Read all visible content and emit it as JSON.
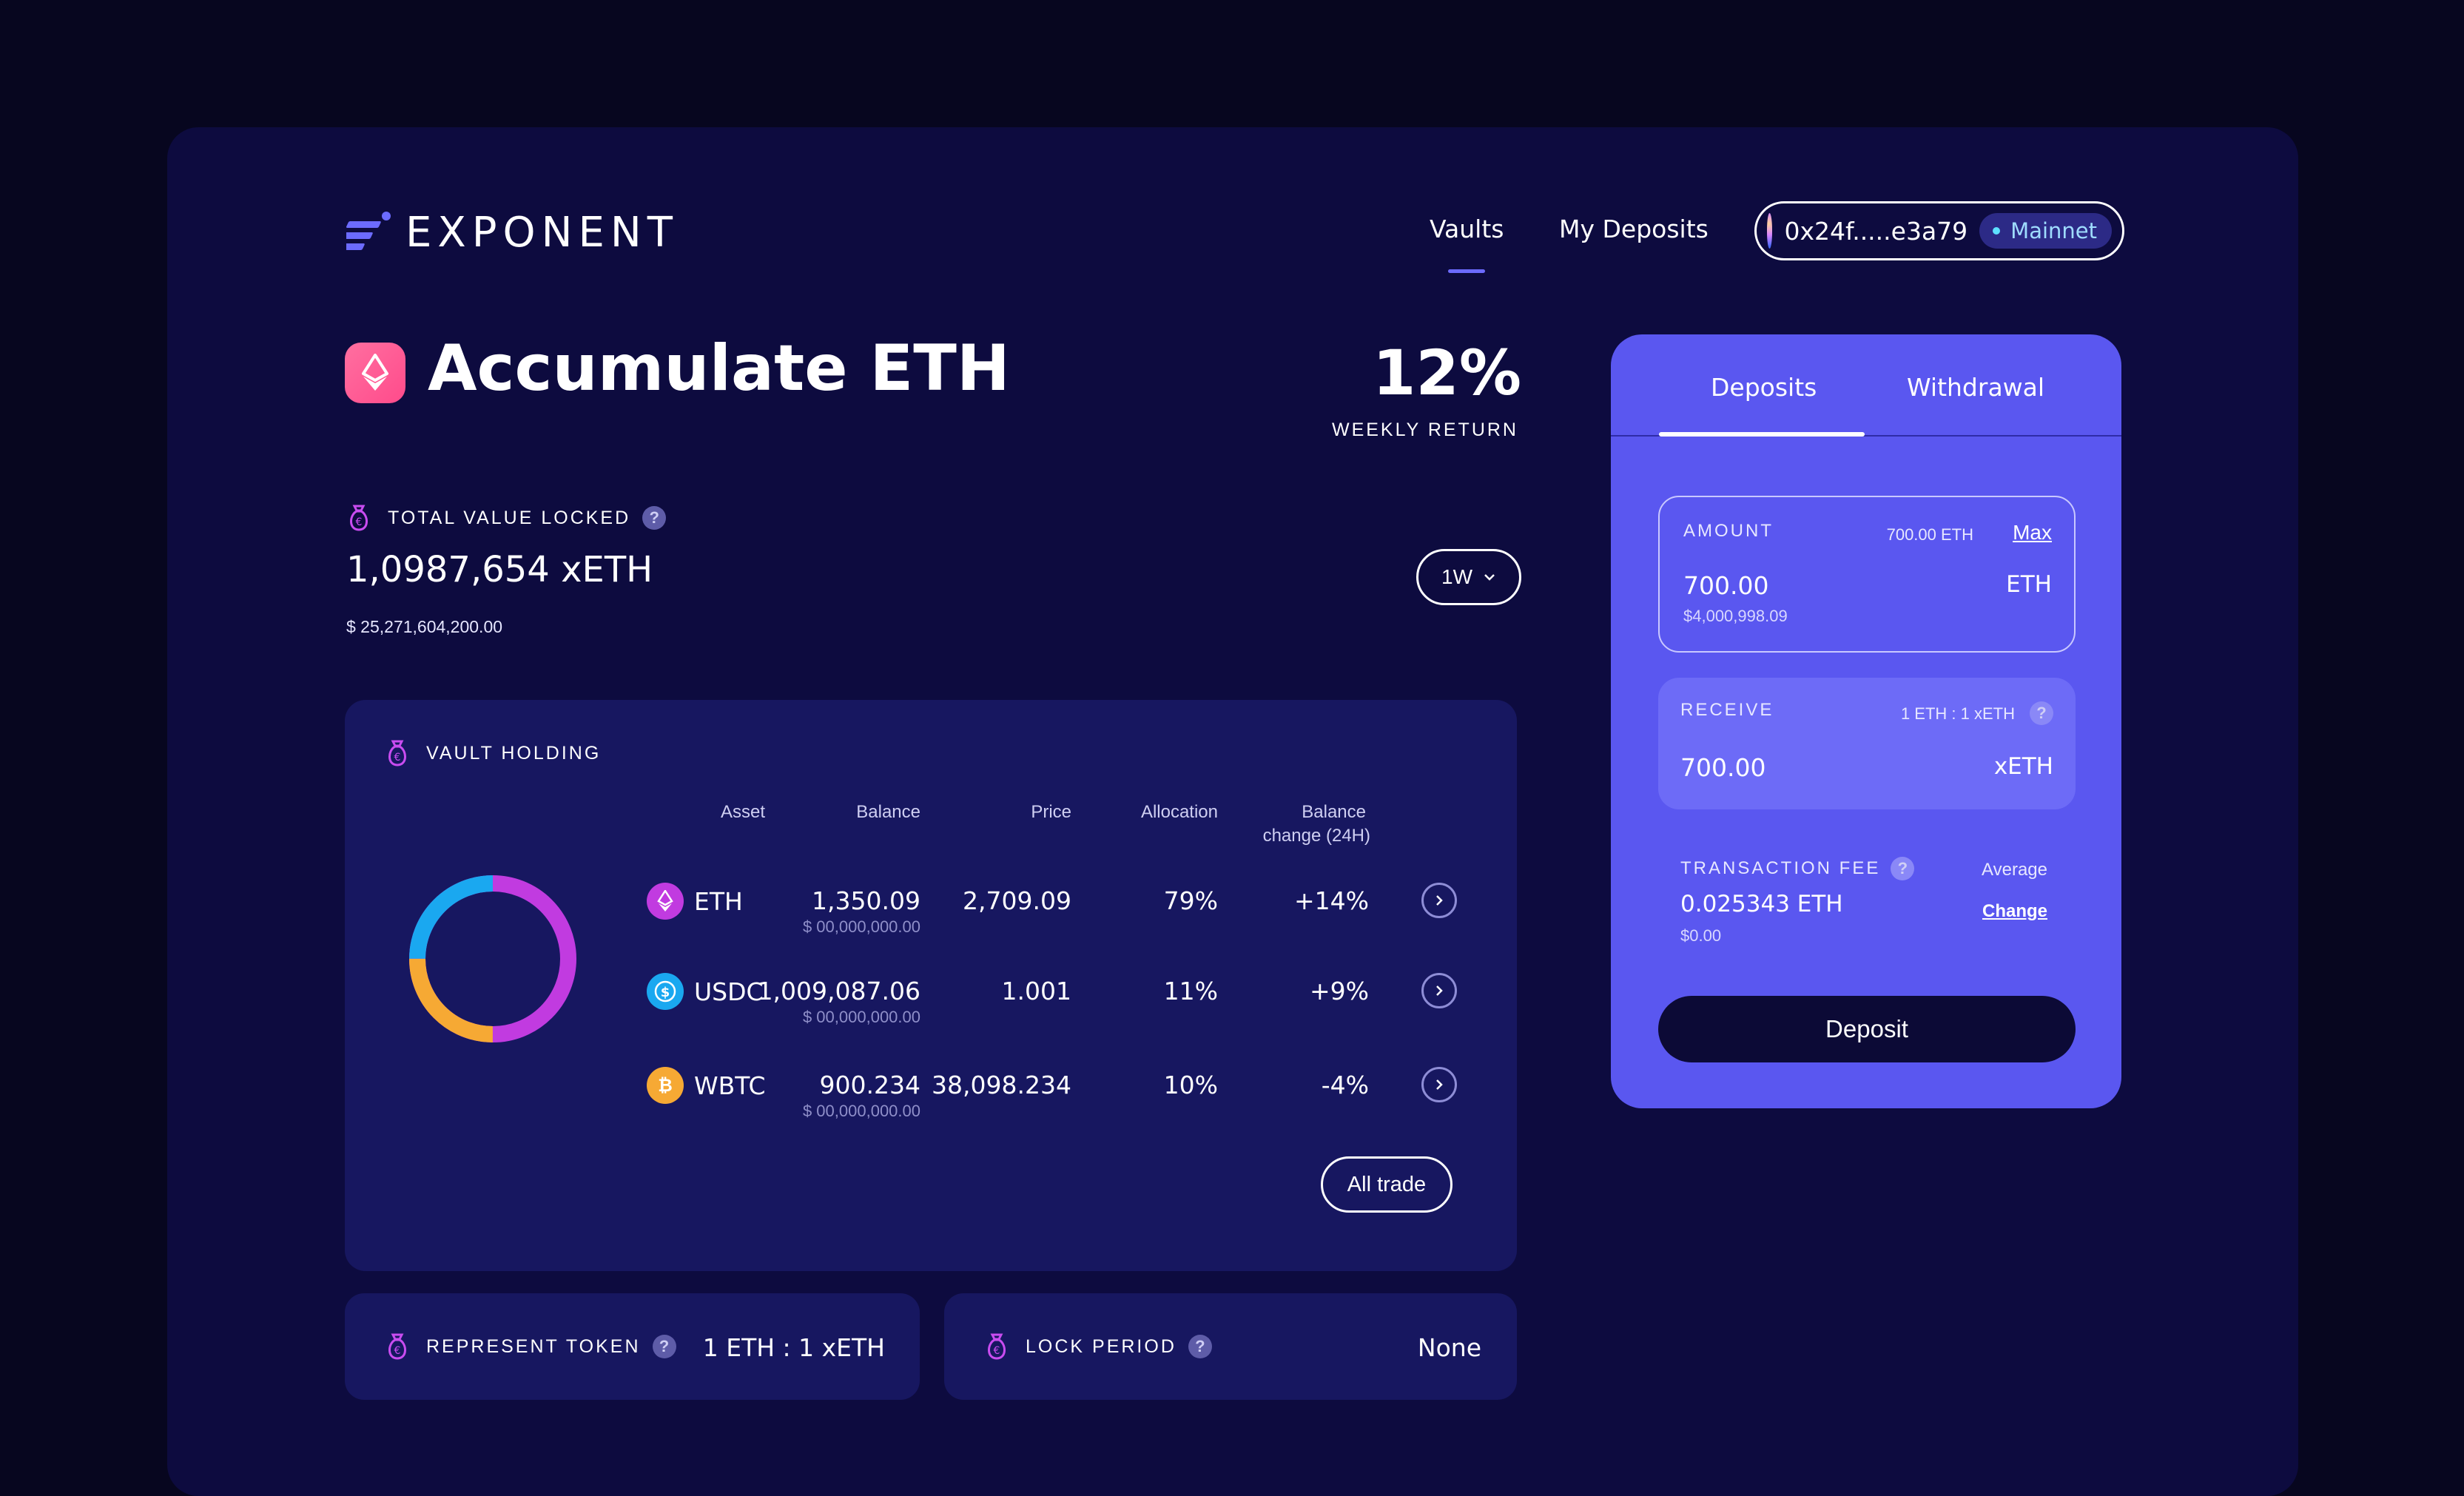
{
  "brand": {
    "name": "EXPONENT"
  },
  "nav": {
    "items": [
      {
        "label": "Vaults",
        "active": true
      },
      {
        "label": "My Deposits",
        "active": false
      }
    ]
  },
  "wallet": {
    "address": "0x24f.....e3a79",
    "network": "Mainnet"
  },
  "vault": {
    "title": "Accumulate ETH",
    "weekly_return": "12%",
    "weekly_return_label": "WEEKLY RETURN"
  },
  "tvl": {
    "label": "TOTAL VALUE LOCKED",
    "value": "1,0987,654 xETH",
    "usd": "$ 25,271,604,200.00",
    "period": "1W"
  },
  "holding": {
    "label": "VAULT HOLDING",
    "headers": {
      "asset": "Asset",
      "balance": "Balance",
      "price": "Price",
      "allocation": "Allocation",
      "change_line1": "Balance",
      "change_line2": "change (24H)"
    },
    "rows": [
      {
        "asset": "ETH",
        "balance": "1,350.09",
        "balance_usd": "$ 00,000,000.00",
        "price": "2,709.09",
        "allocation": "79%",
        "change": "+14%",
        "color": "#c13be0"
      },
      {
        "asset": "USDC",
        "balance": "1,009,087.06",
        "balance_usd": "$ 00,000,000.00",
        "price": "1.001",
        "allocation": "11%",
        "change": "+9%",
        "color": "#1aa8f0"
      },
      {
        "asset": "WBTC",
        "balance": "900.234",
        "balance_usd": "$ 00,000,000.00",
        "price": "38,098.234",
        "allocation": "10%",
        "change": "-4%",
        "color": "#f6a934"
      }
    ],
    "all_trade": "All trade",
    "donut": [
      {
        "name": "ETH",
        "color": "#c13be0",
        "value": 50
      },
      {
        "name": "USDC",
        "color": "#1aa8f0",
        "value": 25
      },
      {
        "name": "WBTC",
        "color": "#f6a934",
        "value": 25
      }
    ]
  },
  "represent_token": {
    "label": "REPRESENT TOKEN",
    "value": "1 ETH : 1 xETH"
  },
  "lock_period": {
    "label": "LOCK PERIOD",
    "value": "None"
  },
  "panel": {
    "tabs": [
      "Deposits",
      "Withdrawal"
    ],
    "amount": {
      "label": "AMOUNT",
      "balance": "700.00 ETH",
      "max": "Max",
      "value": "700.00",
      "usd": "$4,000,998.09",
      "unit": "ETH"
    },
    "receive": {
      "label": "RECEIVE",
      "rate": "1 ETH : 1 xETH",
      "value": "700.00",
      "unit": "xETH"
    },
    "fee": {
      "label": "TRANSACTION FEE",
      "speed": "Average",
      "change": "Change",
      "value": "0.025343 ETH",
      "usd": "$0.00"
    },
    "deposit_button": "Deposit"
  },
  "colors": {
    "background": "#07061f",
    "frame": "#0d0b3f",
    "card": "#171760",
    "panel": "#5a57f0",
    "accent": "#6c6bff"
  }
}
